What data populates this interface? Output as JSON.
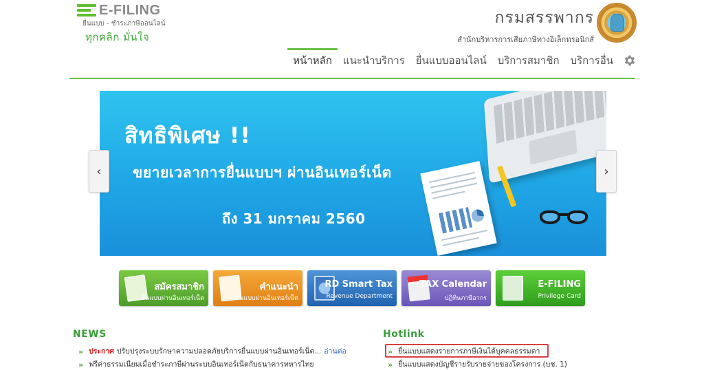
{
  "header": {
    "brand": "E-FILING",
    "brand_sub": "ยื่นแบบ - ชำระภาษีออนไลน์",
    "slogan": "ทุกคลิก มั่นใจ",
    "org_name": "กรมสรรพากร",
    "org_sub": "สำนักบริหารการเสียภาษีทางอิเล็กทรอนิกส์"
  },
  "nav": {
    "items": [
      {
        "label": "หน้าหลัก",
        "active": true
      },
      {
        "label": "แนะนำบริการ",
        "active": false
      },
      {
        "label": "ยื่นแบบออนไลน์",
        "active": false
      },
      {
        "label": "บริการสมาชิก",
        "active": false
      },
      {
        "label": "บริการอื่น",
        "active": false
      }
    ],
    "settings_icon": "gear-icon"
  },
  "banner": {
    "title": "สิทธิพิเศษ !!",
    "line2": "ขยายเวลาการยื่นแบบฯ ผ่านอินเทอร์เน็ต",
    "line3": "ถึง 31 มกราคม 2560",
    "prev": "‹",
    "next": "›"
  },
  "tiles": [
    {
      "title": "สมัครสมาชิก",
      "sub": "ยื่นแบบผ่านอินเทอร์เน็ต",
      "color": "#5aae2e"
    },
    {
      "title": "คำแนะนำ",
      "sub": "ยื่นแบบผ่านอินเทอร์เน็ต",
      "color": "#ec9424"
    },
    {
      "title": "RD Smart Tax",
      "sub": "Revenue Department",
      "color": "#2f78c4"
    },
    {
      "title": "TAX Calendar",
      "sub": "ปฏิทินภาษีอากร",
      "color": "#7d6cc6"
    },
    {
      "title": "E-FILING",
      "sub": "Privilege Card",
      "color": "#3fb42a"
    }
  ],
  "news": {
    "title": "NEWS",
    "items": [
      {
        "tag": "ประกาศ",
        "text": "ปรับปรุงระบบรักษาความปลอดภัยบริการยื่นแบบผ่านอินเทอร์เน็ต...",
        "more": "อ่านต่อ"
      },
      {
        "tag": "",
        "text": "ฟรีค่าธรรมเนียมเมื่อชำระภาษีผ่านระบบอินเทอร์เน็ตกับธนาคารทหารไทย",
        "more": ""
      }
    ]
  },
  "hotlink": {
    "title": "Hotlink",
    "items": [
      {
        "text": "ยื่นแบบแสดงรายการภาษีเงินได้บุคคลธรรมดา"
      },
      {
        "text": "ยื่นแบบแสดงบัญชีรายรับรายจ่ายของโครงการ (บช. 1)"
      }
    ]
  },
  "colors": {
    "accent": "#6ac048",
    "banner": "#1fa7e6",
    "highlight": "#d84040",
    "news_tag": "#d81e1e"
  }
}
